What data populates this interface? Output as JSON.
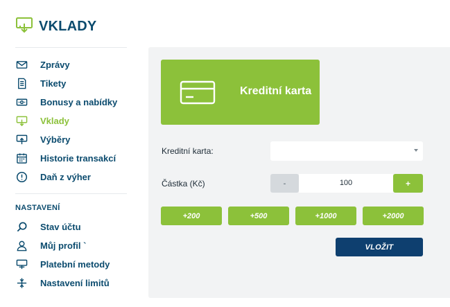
{
  "header": {
    "title": "VKLADY"
  },
  "sidebar": {
    "items": [
      {
        "label": "Zprávy",
        "icon": "envelope-icon"
      },
      {
        "label": "Tikety",
        "icon": "ticket-icon"
      },
      {
        "label": "Bonusy a nabídky",
        "icon": "bonus-ticket-icon"
      },
      {
        "label": "Vklady",
        "icon": "deposit-icon",
        "active": true
      },
      {
        "label": "Výběry",
        "icon": "withdraw-icon"
      },
      {
        "label": "Historie transakcí",
        "icon": "calendar-icon"
      },
      {
        "label": "Daň z výher",
        "icon": "info-circle-icon"
      }
    ],
    "settings_title": "NASTAVENÍ",
    "settings_items": [
      {
        "label": "Stav účtu",
        "icon": "search-icon"
      },
      {
        "label": "Můj profil `",
        "icon": "user-icon"
      },
      {
        "label": "Platební metody",
        "icon": "payment-icon"
      },
      {
        "label": "Nastavení limitů",
        "icon": "limits-icon"
      }
    ]
  },
  "main": {
    "method_card": {
      "label": "Kreditní karta",
      "icon": "credit-card-icon"
    },
    "card_field": {
      "label": "Kreditní karta:",
      "value": ""
    },
    "amount_field": {
      "label": "Částka (Kč)",
      "value": "100",
      "minus": "-",
      "plus": "+"
    },
    "quick_amounts": [
      "+200",
      "+500",
      "+1000",
      "+2000"
    ],
    "submit_label": "VLOŽIT"
  },
  "colors": {
    "accent": "#8cc13a",
    "primary": "#0b4b6e",
    "submit": "#0e3f6f",
    "panel": "#f2f3f4"
  }
}
